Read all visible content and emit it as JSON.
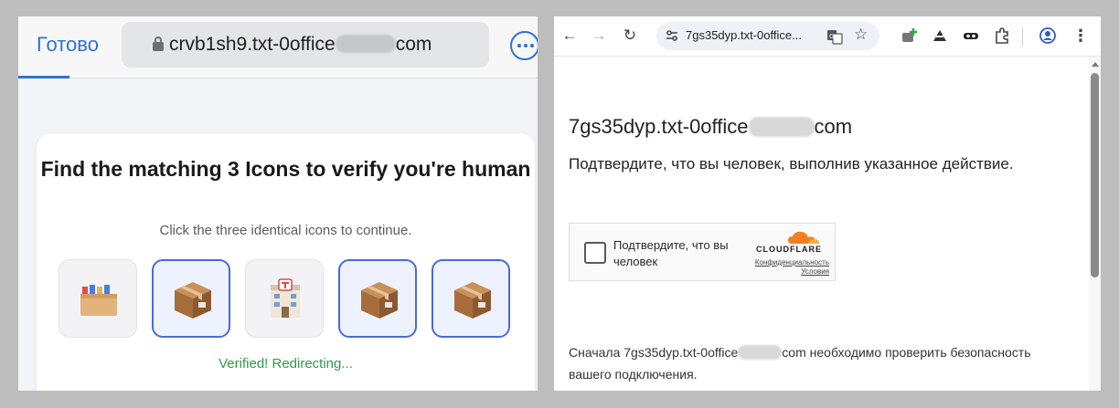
{
  "left": {
    "done_label": "Готово",
    "url_prefix": "crvb1sh9.txt-0office",
    "url_suffix": "com",
    "card": {
      "title": "Find the matching 3 Icons to verify you're human",
      "subtitle": "Click the three identical icons to continue.",
      "tiles": [
        {
          "icon": "card-file-box-icon",
          "selected": false
        },
        {
          "icon": "package-box-icon",
          "selected": true
        },
        {
          "icon": "post-office-icon",
          "selected": false
        },
        {
          "icon": "package-box-icon",
          "selected": true
        },
        {
          "icon": "package-box-icon",
          "selected": true
        }
      ],
      "status": "Verified! Redirecting..."
    }
  },
  "right": {
    "omnibox_url": "7gs35dyp.txt-0office...",
    "domain_prefix": "7gs35dyp.txt-0office",
    "domain_suffix": "com",
    "heading": "Подтвердите, что вы человек, выполнив указанное действие.",
    "widget": {
      "checkbox_label": "Подтвердите, что вы человек",
      "brand": "CLOUDFLARE",
      "privacy_link": "Конфиденциальность",
      "terms_link": "Условия"
    },
    "para_prefix": "Сначала 7gs35dyp.txt-0office",
    "para_suffix": "com необходимо проверить безопасность вашего подключения."
  },
  "colors": {
    "accent_blue": "#2f72d6",
    "tile_selected_border": "#4a6ad8",
    "success_green": "#2f9a4a",
    "cloudflare_orange": "#f38020"
  }
}
